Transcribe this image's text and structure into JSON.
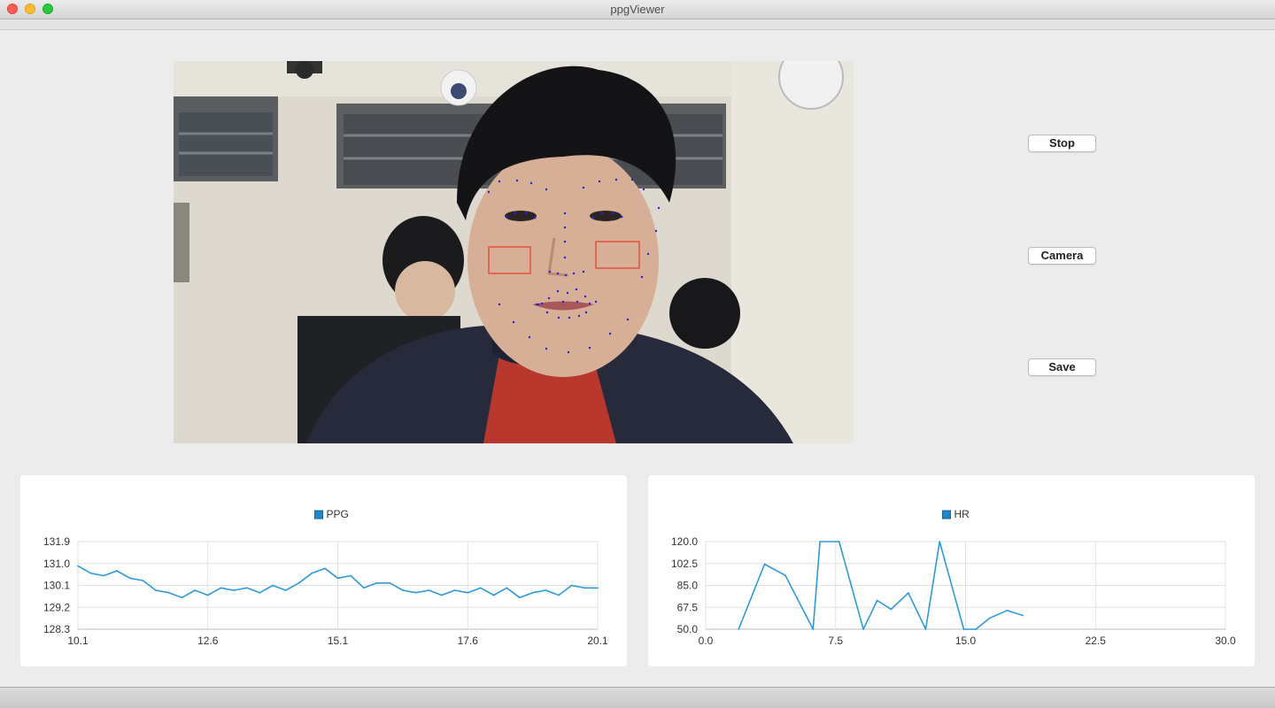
{
  "window": {
    "title": "ppgViewer"
  },
  "video": {
    "roi_color": "#e8392b",
    "landmark_color": "#2a20d8"
  },
  "buttons": {
    "stop": "Stop",
    "camera": "Camera",
    "save": "Save"
  },
  "colors": {
    "series": "#2e9bd6",
    "legend_box": "#1e86c9"
  },
  "chart_data": [
    {
      "type": "line",
      "legend": "PPG",
      "title": "",
      "xlabel": "",
      "ylabel": "",
      "xlim": [
        10.1,
        20.1
      ],
      "ylim": [
        128.3,
        131.9
      ],
      "x_ticks": [
        "10.1",
        "12.6",
        "15.1",
        "17.6",
        "20.1"
      ],
      "y_ticks": [
        "131.9",
        "131.0",
        "130.1",
        "129.2",
        "128.3"
      ],
      "grid": true,
      "legend_position": "top-center",
      "series": [
        {
          "name": "PPG",
          "x": [
            10.1,
            10.35,
            10.6,
            10.85,
            11.1,
            11.35,
            11.6,
            11.85,
            12.1,
            12.35,
            12.6,
            12.85,
            13.1,
            13.35,
            13.6,
            13.85,
            14.1,
            14.35,
            14.6,
            14.85,
            15.1,
            15.35,
            15.6,
            15.85,
            16.1,
            16.35,
            16.6,
            16.85,
            17.1,
            17.35,
            17.6,
            17.85,
            18.1,
            18.35,
            18.6,
            18.85,
            19.1,
            19.35,
            19.6,
            19.85,
            20.1
          ],
          "values": [
            130.9,
            130.6,
            130.5,
            130.7,
            130.4,
            130.3,
            129.9,
            129.8,
            129.6,
            129.9,
            129.7,
            130.0,
            129.9,
            130.0,
            129.8,
            130.1,
            129.9,
            130.2,
            130.6,
            130.8,
            130.4,
            130.5,
            130.0,
            130.2,
            130.2,
            129.9,
            129.8,
            129.9,
            129.7,
            129.9,
            129.8,
            130.0,
            129.7,
            130.0,
            129.6,
            129.8,
            129.9,
            129.7,
            130.1,
            130.0,
            130.0
          ]
        }
      ]
    },
    {
      "type": "line",
      "legend": "HR",
      "title": "",
      "xlabel": "",
      "ylabel": "",
      "xlim": [
        0.0,
        30.0
      ],
      "ylim": [
        50.0,
        120.0
      ],
      "x_ticks": [
        "0.0",
        "7.5",
        "15.0",
        "22.5",
        "30.0"
      ],
      "y_ticks": [
        "120.0",
        "102.5",
        "85.0",
        "67.5",
        "50.0"
      ],
      "grid": true,
      "legend_position": "top-center",
      "series": [
        {
          "name": "HR",
          "x": [
            1.9,
            3.4,
            4.6,
            6.2,
            6.6,
            7.7,
            9.1,
            9.9,
            10.7,
            11.7,
            12.7,
            13.5,
            14.9,
            15.6,
            16.4,
            17.4,
            18.3
          ],
          "values": [
            50.0,
            102.0,
            93.0,
            50.0,
            120.0,
            120.0,
            50.0,
            73.0,
            66.0,
            79.0,
            50.0,
            120.0,
            50.0,
            50.0,
            59.0,
            65.0,
            61.0
          ]
        }
      ]
    }
  ]
}
